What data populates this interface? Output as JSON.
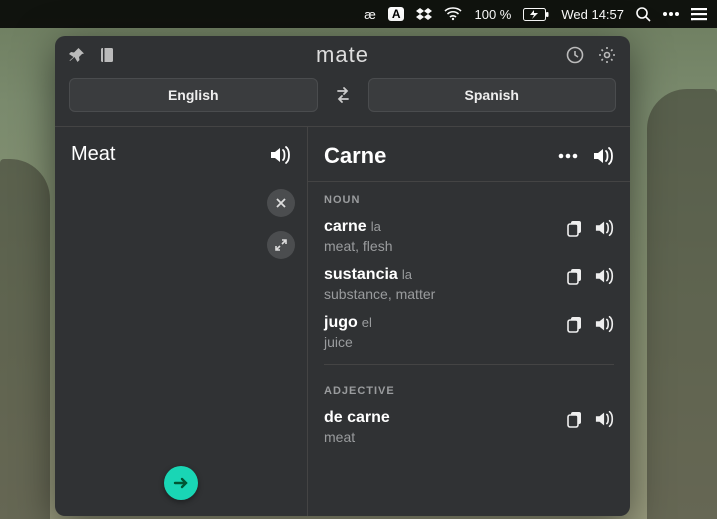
{
  "menubar": {
    "brand": "æ",
    "badge": "A",
    "battery": "100 %",
    "datetime": "Wed 14:57"
  },
  "app": {
    "title": "mate"
  },
  "languages": {
    "source": "English",
    "target": "Spanish"
  },
  "source": {
    "text": "Meat"
  },
  "translation": {
    "text": "Carne",
    "sections": [
      {
        "label": "NOUN",
        "entries": [
          {
            "term": "carne",
            "gender": "la",
            "gloss": "meat, flesh"
          },
          {
            "term": "sustancia",
            "gender": "la",
            "gloss": "substance, matter"
          },
          {
            "term": "jugo",
            "gender": "el",
            "gloss": "juice"
          }
        ]
      },
      {
        "label": "ADJECTIVE",
        "entries": [
          {
            "term": "de carne",
            "gender": "",
            "gloss": "meat"
          }
        ]
      }
    ]
  }
}
